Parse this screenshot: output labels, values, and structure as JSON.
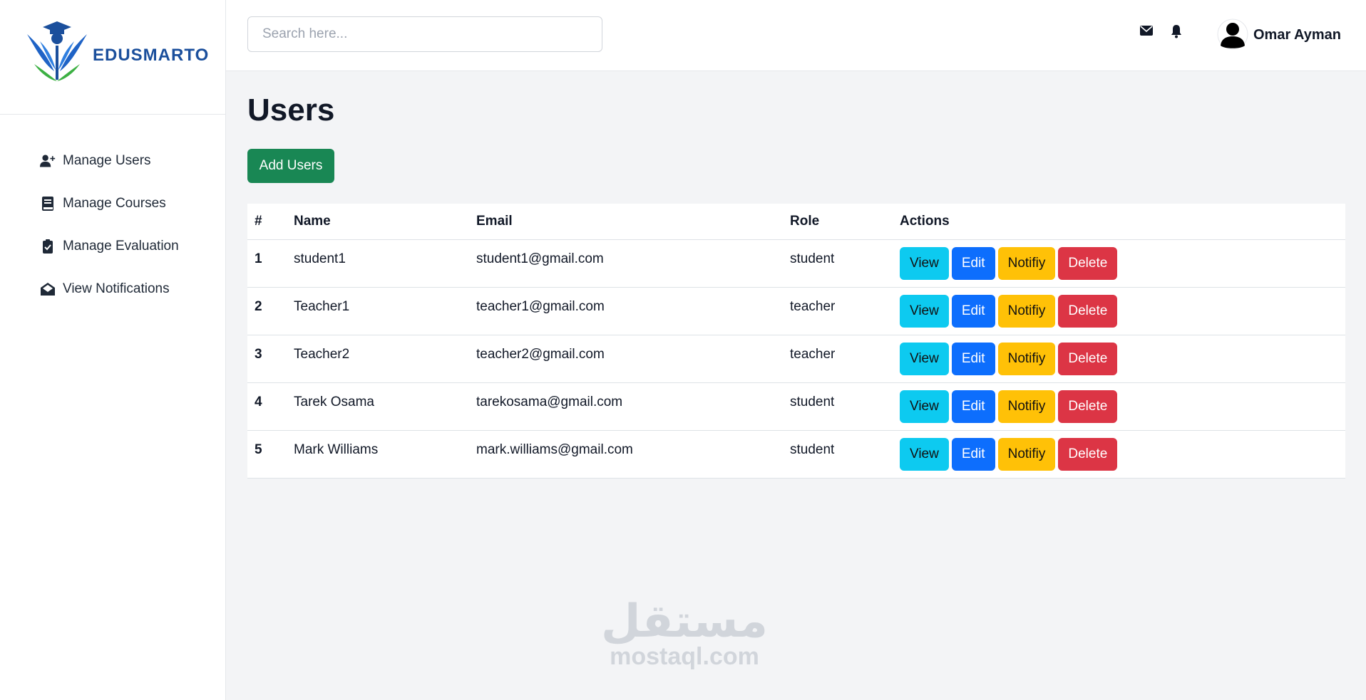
{
  "brand": {
    "name": "EDUSMARTO"
  },
  "sidebar": {
    "items": [
      {
        "label": "Manage Users",
        "icon": "user-plus-icon"
      },
      {
        "label": "Manage Courses",
        "icon": "book-icon"
      },
      {
        "label": "Manage Evaluation",
        "icon": "clipboard-check-icon"
      },
      {
        "label": "View Notifications",
        "icon": "envelope-open-icon"
      }
    ]
  },
  "header": {
    "search_placeholder": "Search here...",
    "user_name": "Omar Ayman"
  },
  "main": {
    "title": "Users",
    "add_button": "Add Users",
    "table": {
      "headers": [
        "#",
        "Name",
        "Email",
        "Role",
        "Actions"
      ],
      "rows": [
        {
          "num": "1",
          "name": "student1",
          "email": "student1@gmail.com",
          "role": "student"
        },
        {
          "num": "2",
          "name": "Teacher1",
          "email": "teacher1@gmail.com",
          "role": "teacher"
        },
        {
          "num": "3",
          "name": "Teacher2",
          "email": "teacher2@gmail.com",
          "role": "teacher"
        },
        {
          "num": "4",
          "name": "Tarek Osama",
          "email": "tarekosama@gmail.com",
          "role": "student"
        },
        {
          "num": "5",
          "name": "Mark Williams",
          "email": "mark.williams@gmail.com",
          "role": "student"
        }
      ],
      "actions": {
        "view": "View",
        "edit": "Edit",
        "notify": "Notifiy",
        "delete": "Delete"
      }
    }
  },
  "watermark": {
    "arabic": "مستقل",
    "latin": "mostaql.com"
  },
  "colors": {
    "success": "#198754",
    "info": "#0dcaf0",
    "primary": "#0d6efd",
    "warning": "#ffc107",
    "danger": "#dc3545",
    "brand": "#1b4f9c"
  }
}
